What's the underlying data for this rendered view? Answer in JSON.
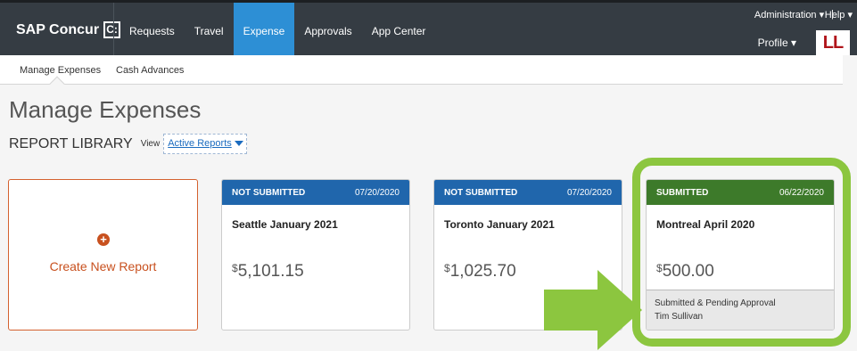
{
  "header": {
    "logo_text": "SAP Concur",
    "logo_mark": "C:",
    "nav": [
      "Requests",
      "Travel",
      "Expense",
      "Approvals",
      "App Center"
    ],
    "active_nav": "Expense",
    "administration": "Administration ▾",
    "separator": "|",
    "help": "Help ▾",
    "profile": "Profile ▾",
    "avatar_initials": "LL"
  },
  "subnav": {
    "items": [
      "Manage Expenses",
      "Cash Advances"
    ]
  },
  "page": {
    "title": "Manage Expenses",
    "library_title": "REPORT LIBRARY",
    "view_label": "View",
    "view_value": "Active Reports"
  },
  "create_card": {
    "plus": "+",
    "label": "Create New Report"
  },
  "reports": [
    {
      "status": "NOT SUBMITTED",
      "date": "07/20/2020",
      "name": "Seattle January 2021",
      "currency": "$",
      "amount": "5,101.15"
    },
    {
      "status": "NOT SUBMITTED",
      "date": "07/20/2020",
      "name": "Toronto January 2021",
      "currency": "$",
      "amount": "1,025.70"
    },
    {
      "status": "SUBMITTED",
      "date": "06/22/2020",
      "name": "Montreal April 2020",
      "currency": "$",
      "amount": "500.00",
      "footer_line1": "Submitted & Pending Approval",
      "footer_line2": "Tim Sullivan"
    }
  ],
  "colors": {
    "topbar": "#353c43",
    "active_nav": "#2d8fd5",
    "not_submitted": "#2066ac",
    "submitted": "#3d7a2a",
    "create_accent": "#c8511f",
    "highlight": "#8cc63f"
  },
  "annotations": {
    "highlight_shape": "rounded-rectangle",
    "arrow_icon": "arrow-right-icon"
  }
}
